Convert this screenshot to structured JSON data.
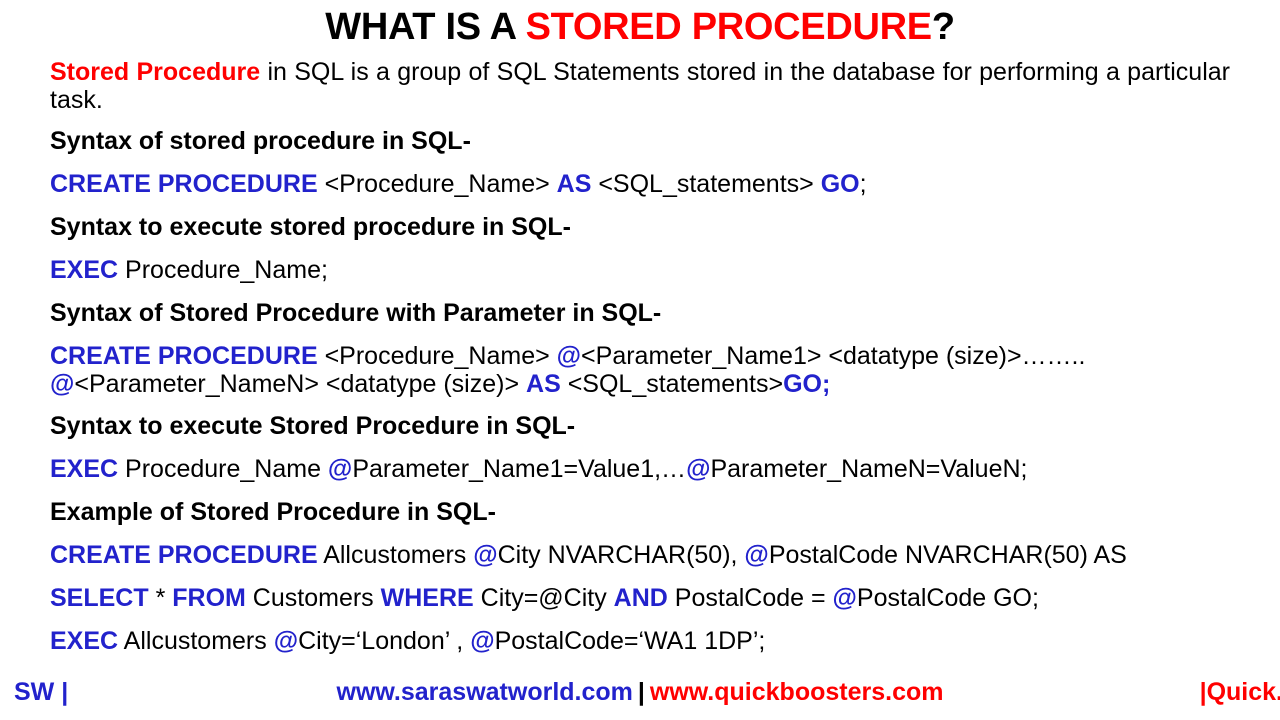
{
  "title": {
    "black_part": "WHAT IS A ",
    "red_part": "STORED PROCEDURE",
    "tail": "?"
  },
  "intro": {
    "highlight": "Stored Procedure",
    "rest": " in SQL is a group of SQL Statements stored in the database for performing a particular task."
  },
  "sections": [
    {
      "heading": "Syntax of stored procedure in SQL-"
    },
    {
      "heading": "Syntax to execute stored procedure in SQL-"
    },
    {
      "heading": "Syntax of Stored Procedure with Parameter in SQL-"
    },
    {
      "heading": "Syntax to execute Stored Procedure in SQL-"
    },
    {
      "heading": "Example of Stored Procedure in SQL-"
    }
  ],
  "code": {
    "line1": {
      "kw1": "CREATE PROCEDURE",
      "t1": " <Procedure_Name> ",
      "kw2": "AS",
      "t2": " <SQL_statements> ",
      "kw3": "GO",
      "t3": ";"
    },
    "line2": {
      "kw1": "EXEC",
      "t1": " Procedure_Name;"
    },
    "line3": {
      "kw1": "CREATE PROCEDURE",
      "t1": " <Procedure_Name> ",
      "at1": "@",
      "t2": "<Parameter_Name1> <datatype (size)>……..",
      "at2": "@",
      "t3": "<Parameter_NameN> <datatype (size)> ",
      "kw2": "AS",
      "t4": " <SQL_statements>",
      "kw3": "GO;"
    },
    "line4": {
      "kw1": "EXEC",
      "t1": " Procedure_Name ",
      "at1": "@",
      "t2": "Parameter_Name1=Value1,…",
      "at2": "@",
      "t3": "Parameter_NameN=ValueN;"
    },
    "line5": {
      "kw1": "CREATE PROCEDURE",
      "t1": " Allcustomers ",
      "at1": "@",
      "t2": "City NVARCHAR(50), ",
      "at2": "@",
      "t3": "PostalCode NVARCHAR(50) AS"
    },
    "line6": {
      "kw1": "SELECT",
      "t1": " * ",
      "kw2": "FROM",
      "t2": " Customers ",
      "kw3": "WHERE",
      "t3": " City=@City ",
      "kw4": "AND",
      "t4": "  PostalCode = ",
      "at1": "@",
      "t5": "PostalCode  GO;"
    },
    "line7": {
      "kw1": "EXEC",
      "t1": " Allcustomers ",
      "at1": "@",
      "t2": "City=‘London’ , ",
      "at2": "@",
      "t3": "PostalCode=‘WA1 1DP’;"
    }
  },
  "footer": {
    "left": "SW |",
    "site1": "www.saraswatworld.com",
    "separator": "|",
    "site2": "www.quickboosters.com",
    "right": "|Quick."
  },
  "colors": {
    "red": "#FF0000",
    "blue": "#2222CC",
    "black": "#000000",
    "background": "#FFFFFF"
  }
}
